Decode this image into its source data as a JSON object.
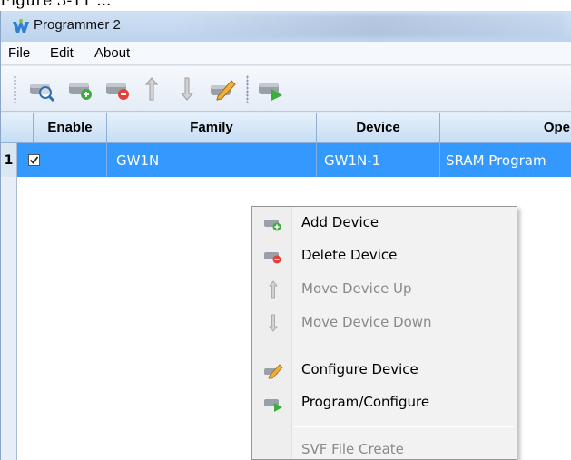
{
  "caption": "Figure 3-11 ...",
  "window": {
    "title": "Programmer 2"
  },
  "menu": {
    "items": [
      {
        "label": "File"
      },
      {
        "label": "Edit"
      },
      {
        "label": "About"
      }
    ]
  },
  "toolbar": {
    "buttons": [
      {
        "icon": "scan-device-icon"
      },
      {
        "icon": "add-device-icon"
      },
      {
        "icon": "delete-device-icon"
      },
      {
        "icon": "move-up-icon"
      },
      {
        "icon": "move-down-icon"
      },
      {
        "icon": "configure-device-icon"
      },
      {
        "icon": "program-configure-icon"
      }
    ]
  },
  "grid": {
    "columns": [
      "Enable",
      "Family",
      "Device",
      "Ope"
    ],
    "rows": [
      {
        "index": "1",
        "enabled": true,
        "family": "GW1N",
        "device": "GW1N-1",
        "operation": "SRAM Program"
      }
    ],
    "selection_color": "#3399ff"
  },
  "context_menu": {
    "items": [
      {
        "label": "Add Device",
        "icon": "add-device-icon",
        "enabled": true
      },
      {
        "label": "Delete Device",
        "icon": "delete-device-icon",
        "enabled": true
      },
      {
        "label": "Move Device Up",
        "icon": "move-up-icon",
        "enabled": false
      },
      {
        "label": "Move Device Down",
        "icon": "move-down-icon",
        "enabled": false
      },
      {
        "label": "Configure Device",
        "icon": "configure-device-icon",
        "enabled": true
      },
      {
        "label": "Program/Configure",
        "icon": "program-configure-icon",
        "enabled": true
      },
      {
        "label": "SVF File Create",
        "icon": "",
        "enabled": false
      }
    ]
  }
}
